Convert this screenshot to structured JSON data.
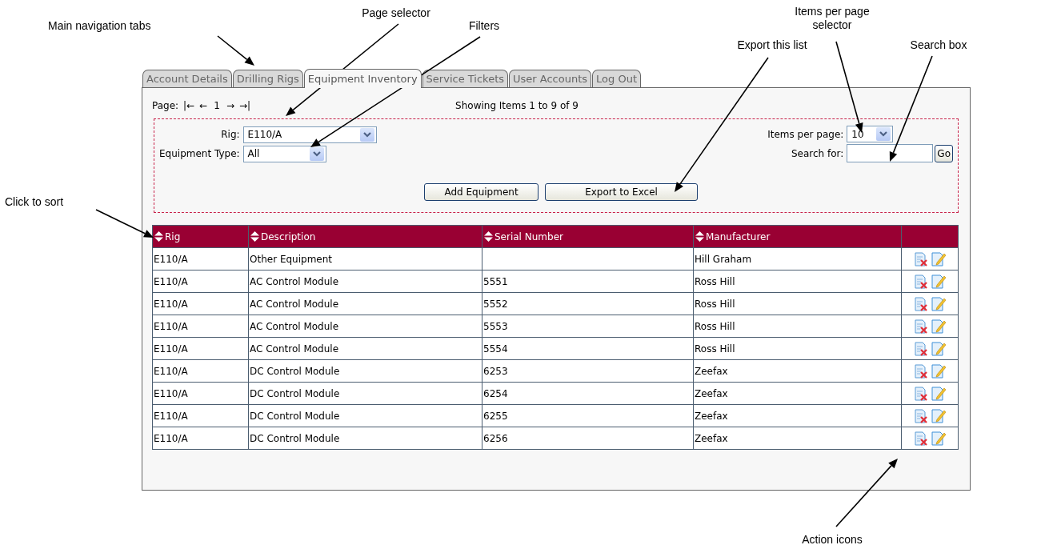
{
  "annotations": [
    {
      "text": "Main navigation tabs"
    },
    {
      "text": "Page selector"
    },
    {
      "text": "Filters"
    },
    {
      "text": "Export this list"
    },
    {
      "text": "Items per page selector"
    },
    {
      "text": "Search box"
    },
    {
      "text": "Click to sort"
    },
    {
      "text": "Action icons"
    }
  ],
  "tabs": [
    {
      "label": "Account Details",
      "selected": false
    },
    {
      "label": "Drilling Rigs",
      "selected": false
    },
    {
      "label": "Equipment Inventory",
      "selected": true
    },
    {
      "label": "Service Tickets",
      "selected": false
    },
    {
      "label": "User Accounts",
      "selected": false
    },
    {
      "label": "Log Out",
      "selected": false
    }
  ],
  "pager": {
    "label": "Page:",
    "first": "|←",
    "prev": "←",
    "current": "1",
    "next": "→",
    "last": "→|",
    "summary": "Showing Items 1 to 9 of 9"
  },
  "filters": {
    "rig": {
      "label": "Rig:",
      "value": "E110/A"
    },
    "equipment_type": {
      "label": "Equipment Type:",
      "value": "All"
    },
    "items_per_page": {
      "label": "Items per page:",
      "value": "10"
    },
    "search": {
      "label": "Search for:",
      "button": "Go"
    }
  },
  "buttons": [
    "Add Equipment",
    "Export to Excel"
  ],
  "table": {
    "columns": [
      "Rig",
      "Description",
      "Serial Number",
      "Manufacturer"
    ],
    "rows": [
      [
        "E110/A",
        "Other Equipment",
        "",
        "Hill Graham"
      ],
      [
        "E110/A",
        "AC Control Module",
        "5551",
        "Ross Hill"
      ],
      [
        "E110/A",
        "AC Control Module",
        "5552",
        "Ross Hill"
      ],
      [
        "E110/A",
        "AC Control Module",
        "5553",
        "Ross Hill"
      ],
      [
        "E110/A",
        "AC Control Module",
        "5554",
        "Ross Hill"
      ],
      [
        "E110/A",
        "DC Control Module",
        "6253",
        "Zeefax"
      ],
      [
        "E110/A",
        "DC Control Module",
        "6254",
        "Zeefax"
      ],
      [
        "E110/A",
        "DC Control Module",
        "6255",
        "Zeefax"
      ],
      [
        "E110/A",
        "DC Control Module",
        "6256",
        "Zeefax"
      ]
    ]
  }
}
